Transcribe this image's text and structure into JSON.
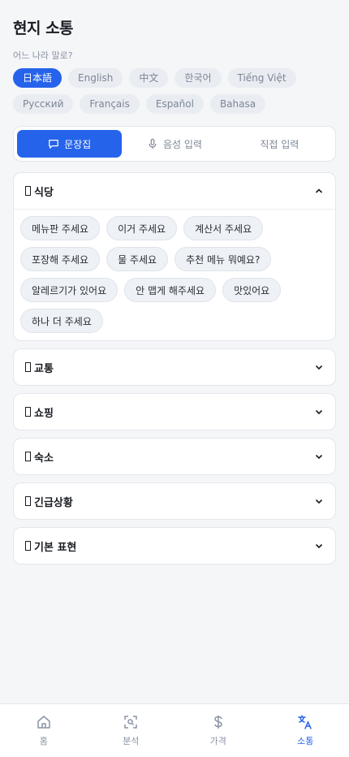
{
  "header": {
    "title": "현지 소통",
    "subtitle": "어느 나라 말로?"
  },
  "languages": {
    "row1": [
      "日本語",
      "English",
      "中文",
      "한국어",
      "Tiếng Việt"
    ],
    "row2": [
      "Русский",
      "Français",
      "Español",
      "Bahasa"
    ],
    "selected": "日本語"
  },
  "modes": {
    "phrasebook": "문장집",
    "voice": "음성 입력",
    "direct": "직접 입력"
  },
  "categories": {
    "dining": {
      "title": "식당",
      "icon": "fork-knife-icon",
      "expanded": true,
      "phrases": [
        "메뉴판 주세요",
        "이거 주세요",
        "계산서 주세요",
        "포장해 주세요",
        "물 주세요",
        "추천 메뉴 뭐예요?",
        "알레르기가 있어요",
        "안 맵게 해주세요",
        "맛있어요",
        "하나 더 주세요"
      ]
    },
    "transport": {
      "title": "교통",
      "icon": "bus-icon"
    },
    "shopping": {
      "title": "쇼핑",
      "icon": "shopping-bag-icon"
    },
    "lodging": {
      "title": "숙소",
      "icon": "hotel-icon"
    },
    "emergency": {
      "title": "긴급상황",
      "icon": "siren-icon"
    },
    "basic": {
      "title": "기본 표현",
      "icon": "speech-icon"
    }
  },
  "tabbar": {
    "home": "홈",
    "analyze": "분석",
    "price": "가격",
    "communicate": "소통",
    "active": "소통"
  },
  "colors": {
    "accent": "#2563eb",
    "background": "#f5f6f8"
  }
}
